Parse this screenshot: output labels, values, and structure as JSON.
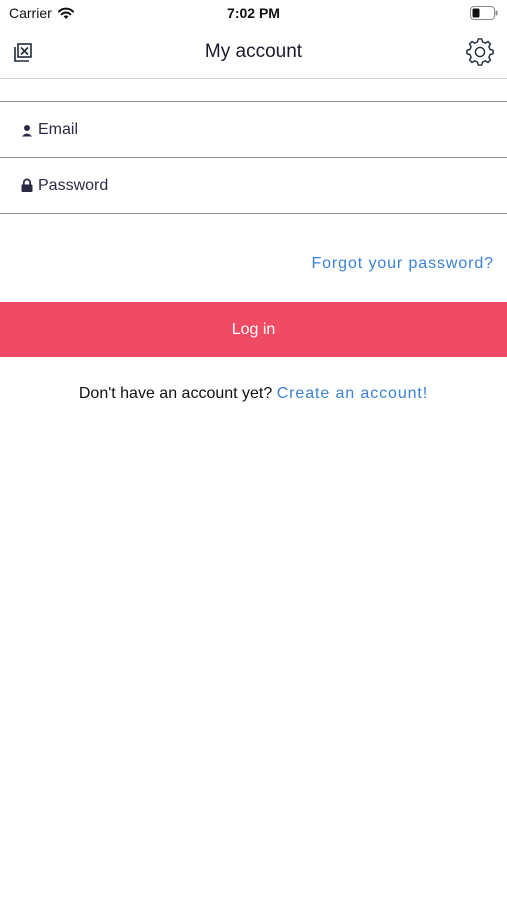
{
  "status_bar": {
    "carrier": "Carrier",
    "time": "7:02 PM",
    "wifi_icon": "wifi-icon",
    "battery_icon": "battery-icon"
  },
  "nav": {
    "title": "My account",
    "left_icon": "close-box-icon",
    "right_icon": "gear-icon"
  },
  "form": {
    "email": {
      "placeholder": "Email",
      "value": "",
      "icon": "user-icon"
    },
    "password": {
      "placeholder": "Password",
      "value": "",
      "icon": "lock-icon"
    },
    "forgot_label": "Forgot your password?",
    "login_label": "Log in",
    "signup_prompt": "Don't have an account yet?",
    "signup_link": "Create an account!"
  },
  "colors": {
    "accent": "#f04b64",
    "link": "#3b82d6",
    "text": "#1a1a2e",
    "divider": "#8e8e93"
  }
}
